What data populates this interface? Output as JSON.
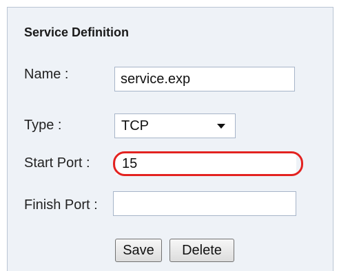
{
  "panel": {
    "title": "Service Definition"
  },
  "form": {
    "name": {
      "label": "Name :",
      "value": "service.exp"
    },
    "type": {
      "label": "Type :",
      "value": "TCP"
    },
    "start_port": {
      "label": "Start Port :",
      "value": "15"
    },
    "finish_port": {
      "label": "Finish Port :",
      "value": ""
    }
  },
  "buttons": {
    "save": "Save",
    "delete": "Delete"
  },
  "colors": {
    "panel_bg": "#eef2f7",
    "highlight": "#e32220",
    "field_border": "#a6b4c8"
  }
}
